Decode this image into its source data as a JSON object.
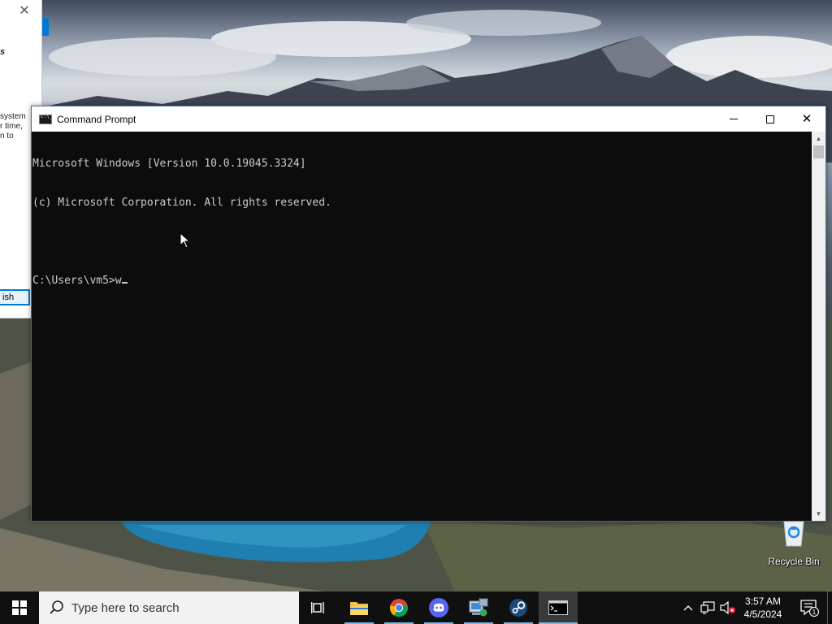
{
  "background_dialog": {
    "close_glyph": "✕",
    "heading_fragment": "s",
    "text_fragment_lines": [
      "system",
      "r time,",
      "n to"
    ],
    "finish_button_label": "ish"
  },
  "cmd_window": {
    "title": "Command Prompt",
    "icon": "cmd-icon",
    "controls": {
      "minimize": "minimize-icon",
      "maximize": "maximize-icon",
      "close": "close-icon"
    },
    "console_lines": [
      "Microsoft Windows [Version 10.0.19045.3324]",
      "(c) Microsoft Corporation. All rights reserved.",
      "",
      "C:\\Users\\vm5>w"
    ]
  },
  "desktop": {
    "recycle_bin_label": "Recycle Bin"
  },
  "taskbar": {
    "search_placeholder": "Type here to search",
    "pinned_apps": [
      {
        "name": "task-view",
        "icon": "task-view-icon"
      },
      {
        "name": "file-explorer",
        "icon": "folder-icon"
      },
      {
        "name": "google-chrome",
        "icon": "chrome-icon"
      },
      {
        "name": "discord",
        "icon": "discord-icon"
      },
      {
        "name": "control-panel",
        "icon": "control-panel-icon"
      },
      {
        "name": "steam",
        "icon": "steam-icon"
      },
      {
        "name": "command-prompt",
        "icon": "cmd-icon",
        "active": true
      }
    ],
    "tray": {
      "chevron": "chevron-up-icon",
      "network": "network-icon",
      "volume": "volume-muted-icon"
    },
    "clock": {
      "time": "3:57 AM",
      "date": "4/5/2024"
    },
    "notification_count": "1"
  },
  "colors": {
    "console_bg": "#0c0c0c",
    "console_fg": "#cccccc",
    "taskbar_bg": "#101010",
    "accent": "#0078d7"
  }
}
